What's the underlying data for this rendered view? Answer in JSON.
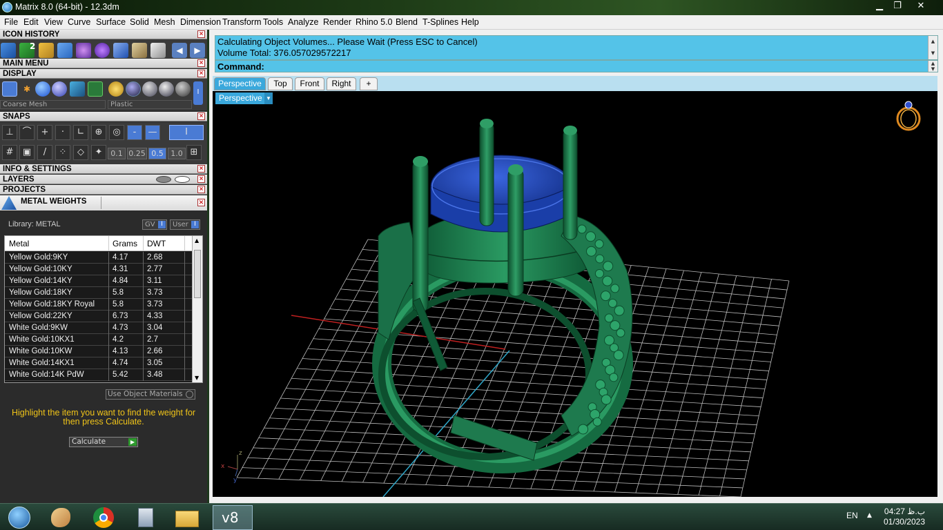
{
  "window": {
    "title": "Matrix 8.0 (64-bit) - 12.3dm",
    "controls": {
      "minimize": "▁",
      "restore": "❐",
      "close": "✕"
    }
  },
  "menubar": {
    "items": [
      "File",
      "Edit",
      "View",
      "Curve",
      "Surface",
      "Solid",
      "Mesh",
      "Dimension",
      "Transform",
      "Tools",
      "Analyze",
      "Render",
      "Rhino 5.0",
      "Blend",
      "T-Splines",
      "Help"
    ]
  },
  "left_panel": {
    "icon_history": {
      "title": "ICON HISTORY",
      "badge": "2"
    },
    "main_menu": {
      "title": "MAIN MENU"
    },
    "display": {
      "title": "DISPLAY",
      "mesh_select": "Coarse Mesh",
      "material_select": "Plastic"
    },
    "snaps": {
      "title": "SNAPS",
      "toggle_label": "I",
      "values": [
        "0.1",
        "0.25",
        "0.5",
        "1.0"
      ]
    },
    "info_settings": {
      "title": "INFO & SETTINGS"
    },
    "layers": {
      "title": "LAYERS"
    },
    "projects": {
      "title": "PROJECTS"
    },
    "metal_weights": {
      "title": "METAL WEIGHTS",
      "library_label": "Library: METAL",
      "gv_label": "GV",
      "user_label": "User",
      "toggle_label": "I",
      "columns": [
        "Metal",
        "Grams",
        "DWT"
      ],
      "rows": [
        [
          "Yellow Gold:9KY",
          "4.17",
          "2.68"
        ],
        [
          "Yellow Gold:10KY",
          "4.31",
          "2.77"
        ],
        [
          "Yellow Gold:14KY",
          "4.84",
          "3.11"
        ],
        [
          "Yellow Gold:18KY",
          "5.8",
          "3.73"
        ],
        [
          "Yellow Gold:18KY Royal",
          "5.8",
          "3.73"
        ],
        [
          "Yellow Gold:22KY",
          "6.73",
          "4.33"
        ],
        [
          "White Gold:9KW",
          "4.73",
          "3.04"
        ],
        [
          "White Gold:10KX1",
          "4.2",
          "2.7"
        ],
        [
          "White Gold:10KW",
          "4.13",
          "2.66"
        ],
        [
          "White Gold:14KX1",
          "4.74",
          "3.05"
        ],
        [
          "White Gold:14K PdW",
          "5.42",
          "3.48"
        ]
      ],
      "use_object_materials": "Use Object Materials",
      "hint": "Highlight the item you want to find the weight for then press Calculate.",
      "calculate_label": "Calculate"
    }
  },
  "command": {
    "line1": "Calculating Object Volumes... Please Wait (Press ESC to Cancel)",
    "line2": "Volume Total: 376.057029572217",
    "prompt": "Command:"
  },
  "viewport": {
    "tabs": [
      "Perspective",
      "Top",
      "Front",
      "Right"
    ],
    "add_tab": "+",
    "active_tab": "Perspective",
    "label": "Perspective",
    "axis": {
      "x": "x",
      "y": "y",
      "z": "z"
    }
  },
  "taskbar": {
    "lang": "EN",
    "time": "04:27 ب.ظ",
    "date": "01/30/2023",
    "active_app": "v8"
  },
  "colors": {
    "accent": "#3aa8dc",
    "command_bg": "#54c3e8",
    "ring_green": "#1e7a4e",
    "stone_blue": "#1f3fa8",
    "hint_yellow": "#f0c419"
  }
}
